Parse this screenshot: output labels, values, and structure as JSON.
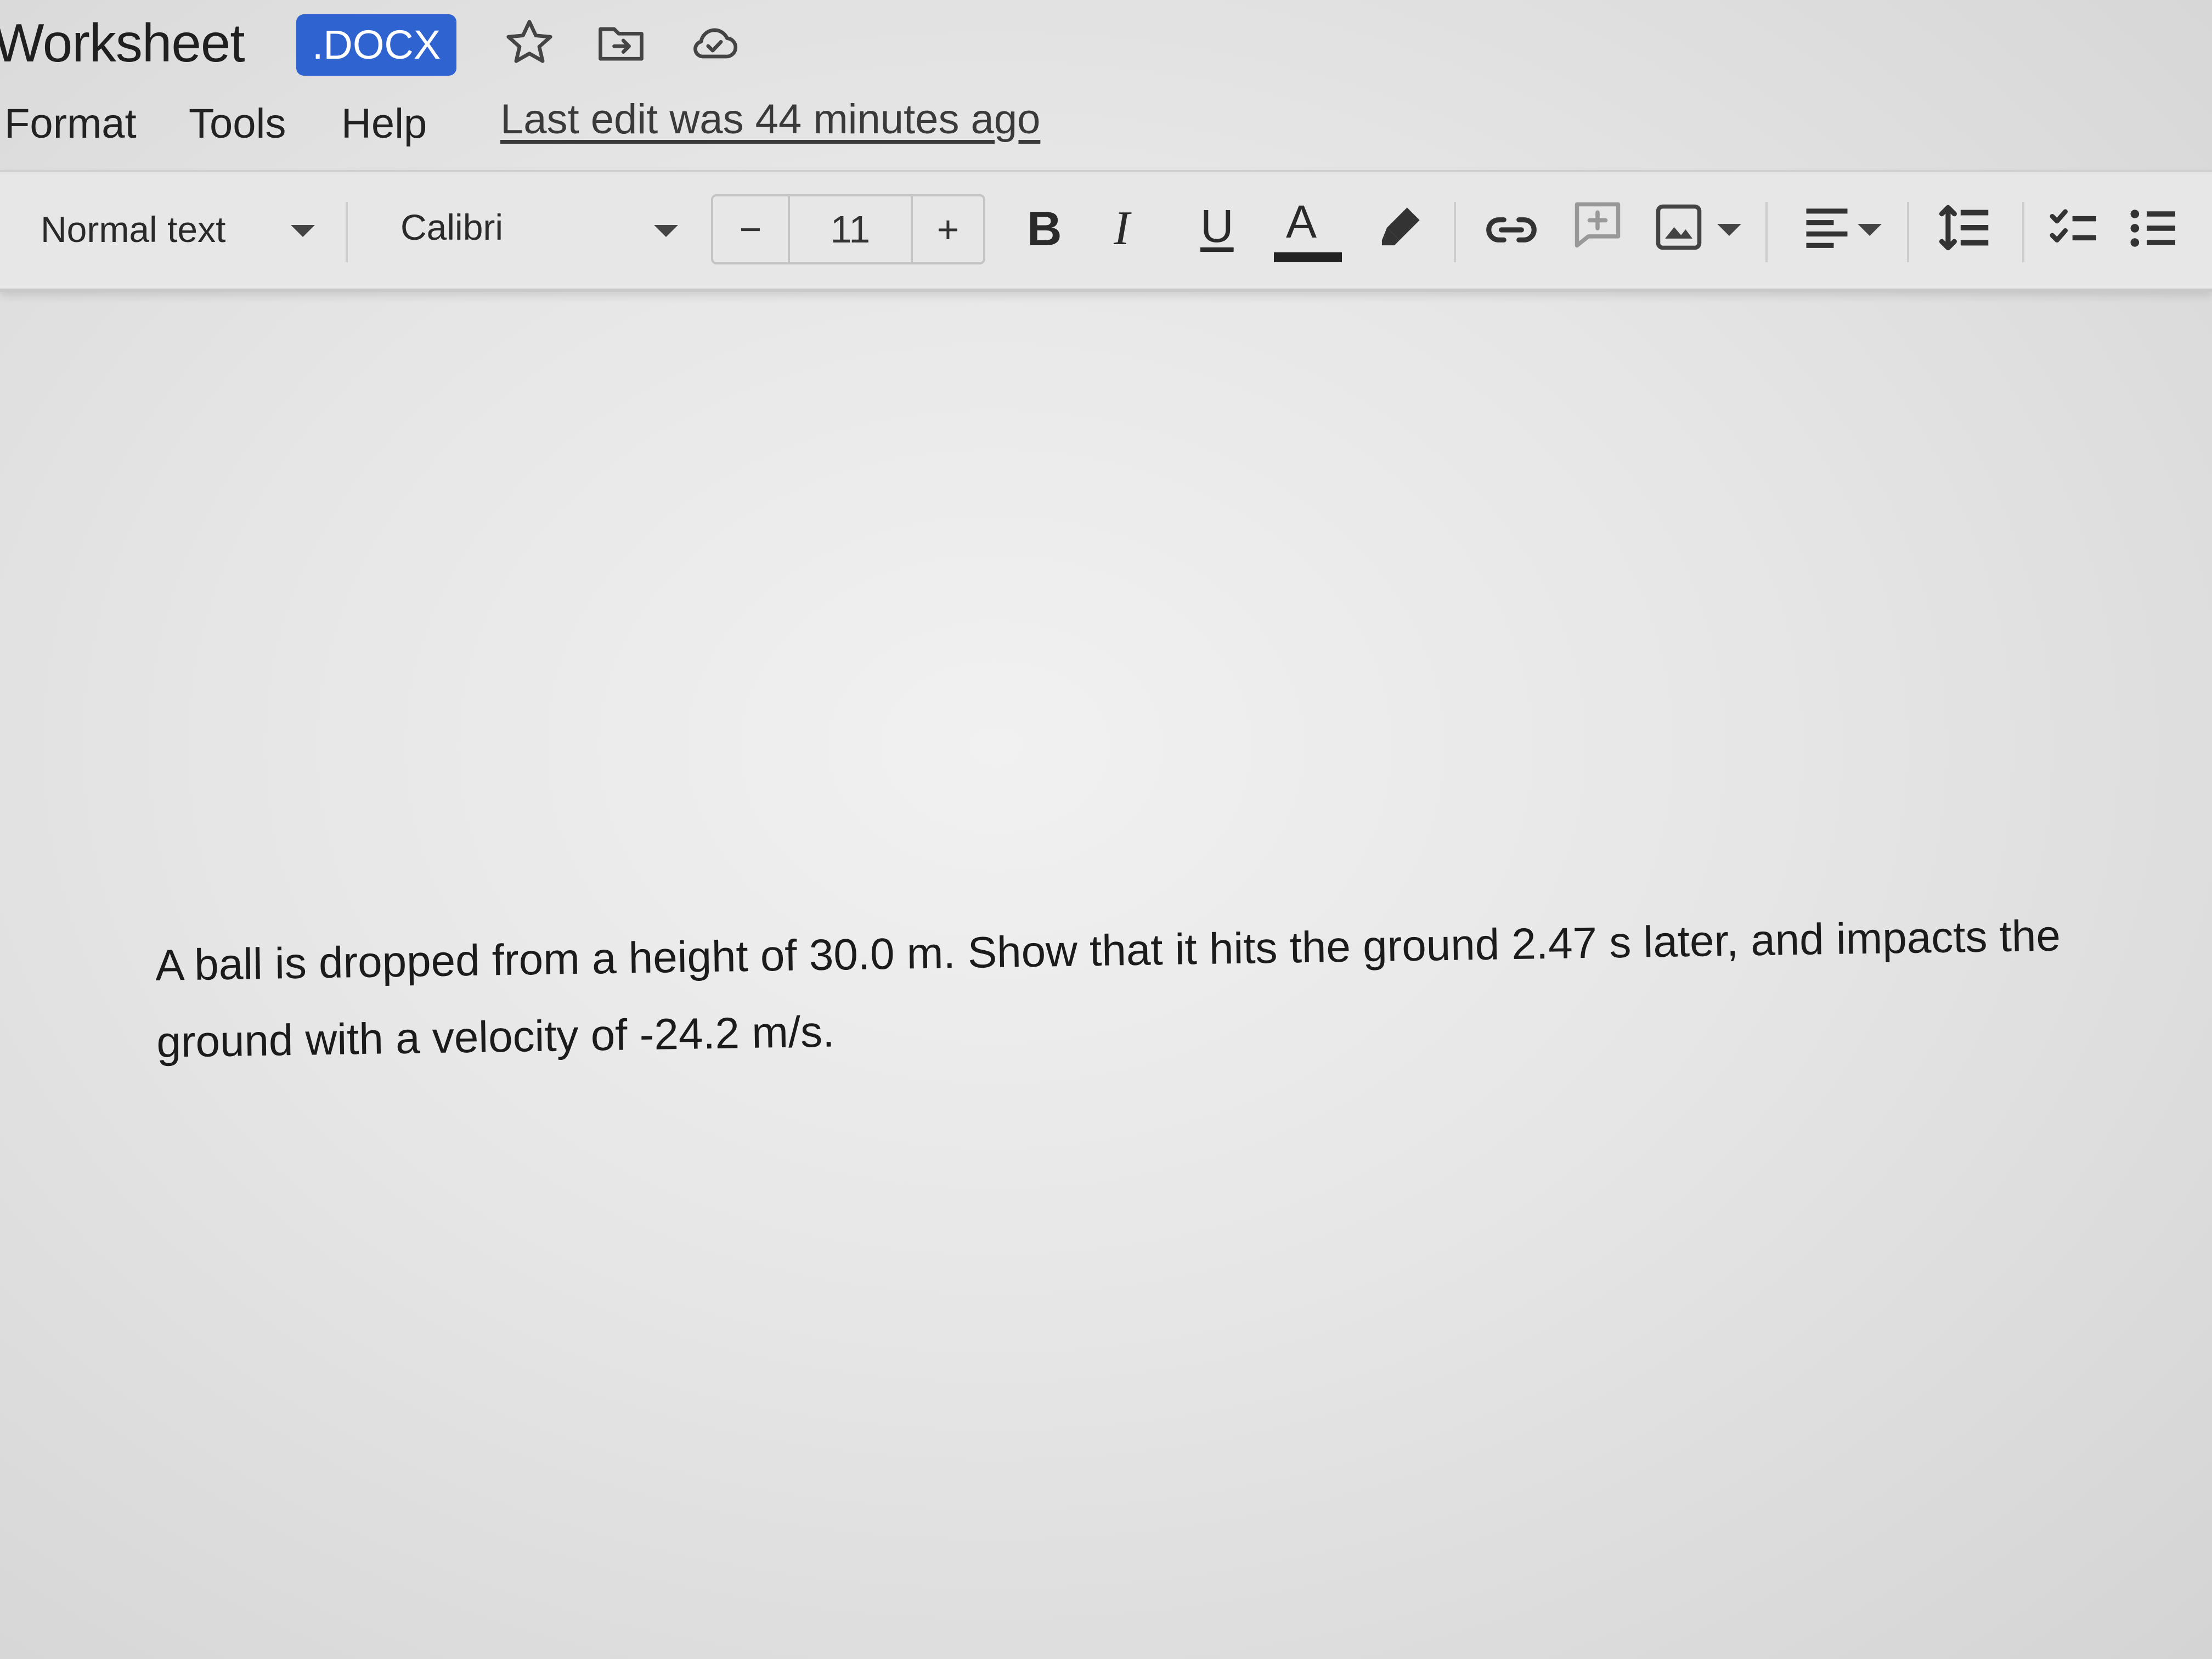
{
  "document": {
    "title": "Worksheet",
    "format_badge": ".DOCX",
    "title_icons": [
      "star-icon",
      "move-to-folder-icon",
      "cloud-status-icon"
    ]
  },
  "menu": {
    "items": [
      "Format",
      "Tools",
      "Help"
    ],
    "last_edit": "Last edit was 44 minutes ago"
  },
  "toolbar": {
    "paragraph_style": "Normal text",
    "font": "Calibri",
    "font_size": "11",
    "decrease_label": "−",
    "increase_label": "+",
    "bold_label": "B",
    "italic_label": "I",
    "underline_label": "U",
    "text_color_label": "A",
    "icons": [
      "highlighter-icon",
      "link-icon",
      "add-comment-icon",
      "insert-image-icon",
      "align-icon",
      "line-spacing-icon",
      "checklist-icon",
      "bulleted-list-icon"
    ]
  },
  "body": {
    "paragraph_line1": "A ball is dropped from a height of 30.0 m.  Show that it hits the ground 2.47 s later, and impacts the",
    "paragraph_line2": "ground with a velocity of -24.2 m/s."
  },
  "colors": {
    "badge": "#2f63cf",
    "text_color_bar": "#222222"
  }
}
